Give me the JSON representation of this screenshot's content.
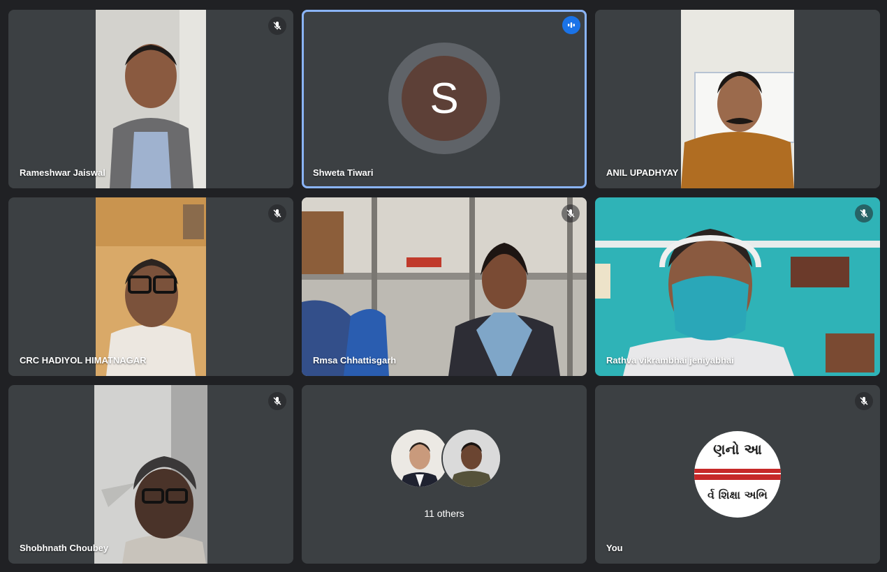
{
  "participants": [
    {
      "name": "Rameshwar Jaiswal",
      "muted": true
    },
    {
      "name": "Shweta Tiwari",
      "initial": "S",
      "speaking": true,
      "avatar_color": "#5d4037"
    },
    {
      "name": "ANIL UPADHYAY",
      "muted": false
    },
    {
      "name": "CRC HADIYOL HIMATNAGAR",
      "muted": true
    },
    {
      "name": "Rmsa Chhattisgarh",
      "muted": true
    },
    {
      "name": "Rathva vikrambhai jeniyabhai",
      "muted": true
    },
    {
      "name": "Shobhnath Choubey",
      "muted": true
    }
  ],
  "others": {
    "label": "11 others"
  },
  "self": {
    "name": "You",
    "muted": true,
    "avatar_text_top": "ણનો આ",
    "avatar_text_bottom": "ર્વ શિક્ષા અભિ"
  },
  "colors": {
    "background": "#202124",
    "tile": "#3c4043",
    "active_border": "#8ab4f8",
    "speaking_badge": "#1a73e8"
  },
  "icons": {
    "mute": "mic-off-icon",
    "speaking": "audio-level-icon"
  }
}
